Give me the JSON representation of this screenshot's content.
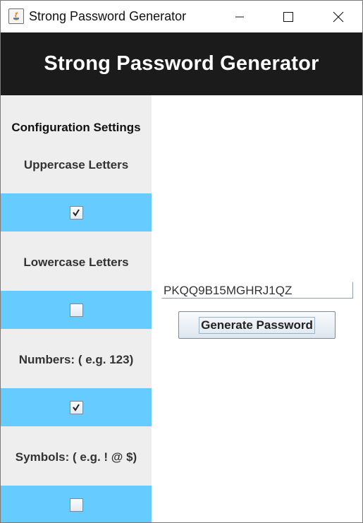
{
  "window": {
    "title": "Strong Password Generator",
    "controls": [
      "minimize-icon",
      "maximize-icon",
      "close-icon"
    ]
  },
  "banner": {
    "title": "Strong Password Generator"
  },
  "config": {
    "heading": "Configuration Settings",
    "options": [
      {
        "label": "Uppercase Letters",
        "checked": true
      },
      {
        "label": "Lowercase Letters",
        "checked": false
      },
      {
        "label": "Numbers: ( e.g. 123)",
        "checked": true
      },
      {
        "label": "Symbols: ( e.g. ! @ $)",
        "checked": false
      }
    ]
  },
  "main": {
    "password_value": "PKQQ9B15MGHRJ1QZ",
    "generate_label": "Generate Password"
  },
  "colors": {
    "banner_bg": "#1b1b1b",
    "config_bg": "#eeeeee",
    "check_band": "#66ccff"
  }
}
